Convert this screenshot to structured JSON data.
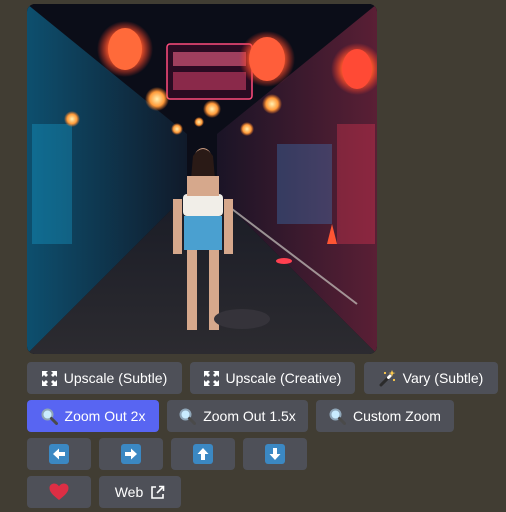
{
  "image": {
    "alt_icon": "generated-image"
  },
  "buttons_row1": {
    "upscale_subtle": "Upscale (Subtle)",
    "upscale_creative": "Upscale (Creative)",
    "vary_subtle": "Vary (Subtle)"
  },
  "buttons_row2": {
    "zoom_out_2x": "Zoom Out 2x",
    "zoom_out_1_5x": "Zoom Out 1.5x",
    "custom_zoom": "Custom Zoom"
  },
  "buttons_row3": {
    "left_icon": "arrow-left-icon",
    "right_icon": "arrow-right-icon",
    "up_icon": "arrow-up-icon",
    "down_icon": "arrow-down-icon"
  },
  "buttons_row4": {
    "favorite_icon": "heart-icon",
    "web_label": "Web",
    "web_icon": "external-link-icon"
  },
  "colors": {
    "background": "#413d33",
    "button": "#4e5058",
    "active_button": "#5865f2",
    "arrow_tile": "#3b88c3",
    "heart": "#dd2e44"
  }
}
